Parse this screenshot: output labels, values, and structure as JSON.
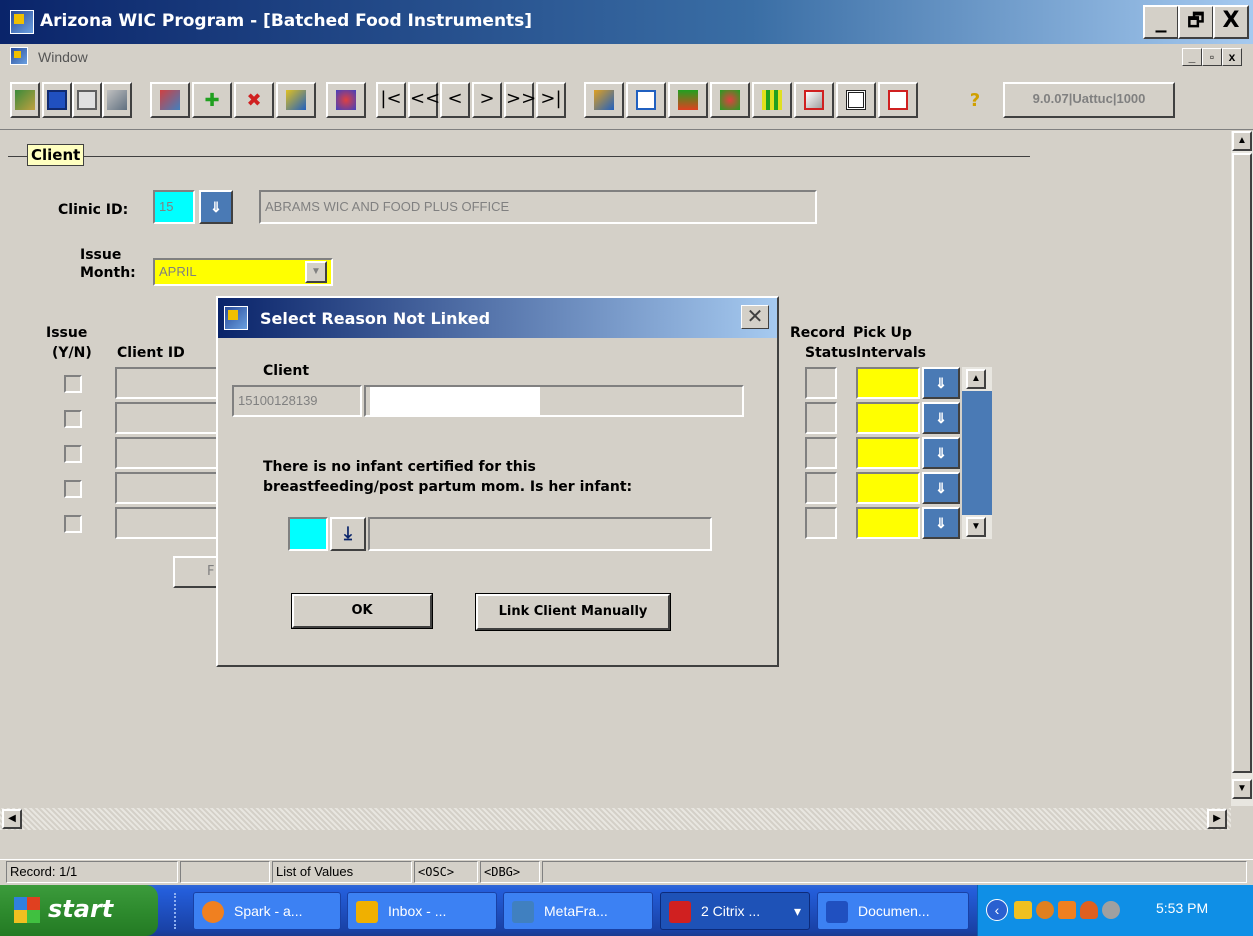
{
  "window": {
    "title": "Arizona WIC Program - [Batched Food Instruments]",
    "controls": [
      "_",
      "🗗",
      "X"
    ],
    "mdi_controls": [
      "_",
      "🗗",
      "X"
    ]
  },
  "menu": {
    "window_label": "Window"
  },
  "toolbar": {
    "nav_buttons": [
      "|<",
      "<<",
      "<",
      ">",
      ">>",
      ">|"
    ],
    "help": "?",
    "version": "9.0.07|Uattuc|1000"
  },
  "section": {
    "client_label": "Client"
  },
  "clinic": {
    "label": "Clinic ID:",
    "id": "15",
    "name": "ABRAMS WIC AND FOOD PLUS OFFICE"
  },
  "issue_month": {
    "label_line1": "Issue",
    "label_line2": "Month:",
    "value": "APRIL"
  },
  "grid": {
    "issue_header_1": "Issue",
    "issue_header_2": "(Y/N)",
    "client_id_header": "Client ID",
    "record_status_header_1": "Record",
    "record_status_header_2": "Status",
    "pickup_header_1": "Pick Up",
    "pickup_header_2": "Intervals",
    "row_count": 5,
    "hidden_button_label": "F"
  },
  "dialog": {
    "title": "Select Reason Not Linked",
    "close": "✕",
    "client_label": "Client",
    "client_id": "15100128139",
    "client_name": "",
    "message_line1": "There is no infant certified for this",
    "message_line2": "breastfeeding/post partum mom.  Is her infant:",
    "reason_code": "",
    "reason_desc": "",
    "ok_label": "OK",
    "link_label": "Link Client Manually"
  },
  "status": {
    "record": "Record: 1/1",
    "blank": "",
    "lov": "List of Values",
    "osc": "<OSC>",
    "dbg": "<DBG>"
  },
  "taskbar": {
    "start": "start",
    "tasks": [
      {
        "label": "Spark - a...",
        "icon_color": "#f08020",
        "icon": "spark-icon"
      },
      {
        "label": "Inbox - ...",
        "icon_color": "#f0b000",
        "icon": "outlook-icon"
      },
      {
        "label": "MetaFra...",
        "icon_color": "#4080c0",
        "icon": "metaframe-icon"
      },
      {
        "label": "2 Citrix ...",
        "icon_color": "#d02020",
        "icon": "citrix-icon"
      },
      {
        "label": "Documen...",
        "icon_color": "#2050c0",
        "icon": "word-icon"
      }
    ],
    "clock": "5:53 PM"
  },
  "colors": {
    "title_start": "#0a246a",
    "title_end": "#a6caf0",
    "lov_button": "#4a7ab5",
    "required_field": "#ffff00",
    "key_field": "#00ffff"
  }
}
